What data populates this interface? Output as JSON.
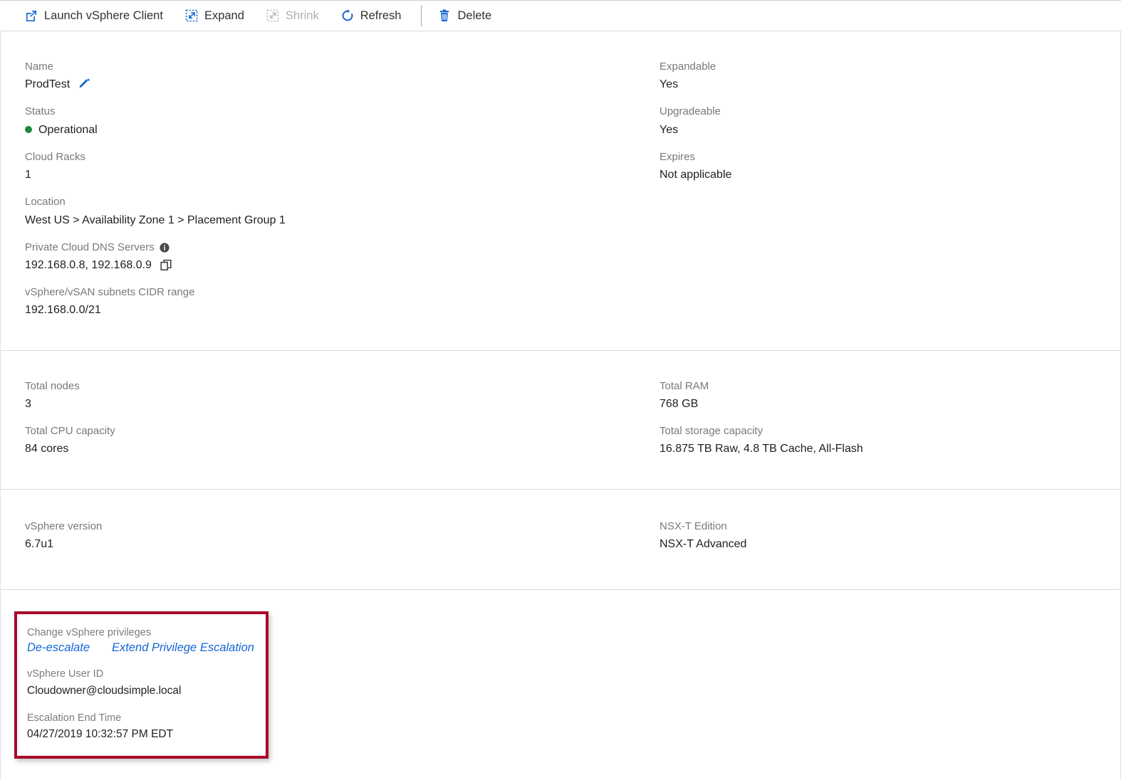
{
  "toolbar": {
    "items": [
      {
        "label": "Launch vSphere Client",
        "icon": "external-link-icon",
        "disabled": false
      },
      {
        "label": "Expand",
        "icon": "expand-icon",
        "disabled": false
      },
      {
        "label": "Shrink",
        "icon": "shrink-icon",
        "disabled": true
      },
      {
        "label": "Refresh",
        "icon": "refresh-icon",
        "disabled": false
      },
      {
        "label": "Delete",
        "icon": "trash-icon",
        "disabled": false
      }
    ]
  },
  "overview": {
    "name": {
      "label": "Name",
      "value": "ProdTest",
      "edit_icon": "pencil-icon"
    },
    "status": {
      "label": "Status",
      "value": "Operational",
      "dot_color": "#1a8a3f"
    },
    "cloud_racks": {
      "label": "Cloud Racks",
      "value": "1"
    },
    "location": {
      "label": "Location",
      "value": "West US > Availability Zone 1 > Placement Group 1"
    },
    "dns": {
      "label": "Private Cloud DNS Servers",
      "info_icon": "info-icon",
      "value": "192.168.0.8, 192.168.0.9",
      "copy_icon": "copy-icon"
    },
    "cidr": {
      "label": "vSphere/vSAN subnets CIDR range",
      "value": "192.168.0.0/21"
    },
    "expandable": {
      "label": "Expandable",
      "value": "Yes"
    },
    "upgradeable": {
      "label": "Upgradeable",
      "value": "Yes"
    },
    "expires": {
      "label": "Expires",
      "value": "Not applicable"
    }
  },
  "capacity": {
    "total_nodes": {
      "label": "Total nodes",
      "value": "3"
    },
    "total_cpu": {
      "label": "Total CPU capacity",
      "value": "84 cores"
    },
    "total_ram": {
      "label": "Total RAM",
      "value": "768 GB"
    },
    "total_storage": {
      "label": "Total storage capacity",
      "value": "16.875 TB Raw, 4.8 TB Cache, All-Flash"
    }
  },
  "versions": {
    "vsphere": {
      "label": "vSphere version",
      "value": "6.7u1"
    },
    "nsxt": {
      "label": "NSX-T Edition",
      "value": "NSX-T Advanced"
    }
  },
  "privileges": {
    "change_label": "Change vSphere privileges",
    "deescalate_link": "De-escalate",
    "extend_link": "Extend Privilege Escalation",
    "user_id": {
      "label": "vSphere User ID",
      "value": "Cloudowner@cloudsimple.local"
    },
    "end_time": {
      "label": "Escalation End Time",
      "value": "04/27/2019 10:32:57 PM EDT"
    },
    "highlight_color": "#a8072a",
    "link_color": "#1666d6"
  }
}
